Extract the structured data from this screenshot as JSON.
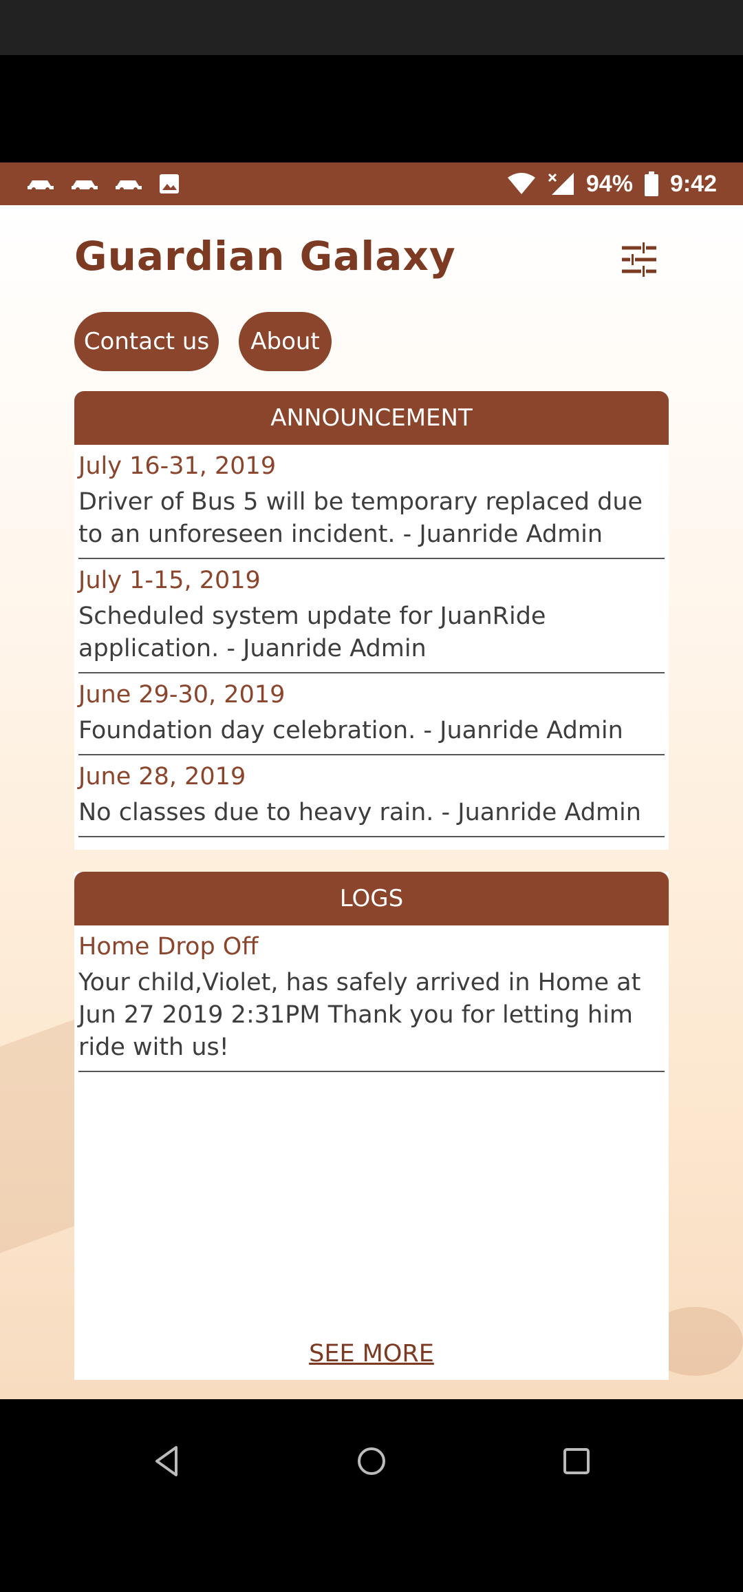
{
  "status": {
    "battery": "94%",
    "time": "9:42",
    "colors": {
      "bar": "#8b452c"
    },
    "icons": [
      "car-icon",
      "car-icon",
      "car-icon",
      "image-icon",
      "wifi-icon",
      "signal-icon",
      "battery-icon"
    ]
  },
  "app": {
    "title": "Guardian Galaxy",
    "buttons": {
      "contact": "Contact us",
      "about": "About"
    },
    "accent": "#8b452c"
  },
  "announcement": {
    "header": "ANNOUNCEMENT",
    "items": [
      {
        "date": "July 16-31, 2019",
        "text": "Driver of Bus 5 will be temporary replaced due to an unforeseen incident. - Juanride Admin"
      },
      {
        "date": "July 1-15, 2019",
        "text": "Scheduled system update for JuanRide application. - Juanride Admin"
      },
      {
        "date": "June 29-30, 2019",
        "text": "Foundation day celebration. - Juanride Admin"
      },
      {
        "date": "June 28, 2019",
        "text": "No classes due to heavy rain. - Juanride Admin"
      }
    ]
  },
  "logs": {
    "header": "LOGS",
    "items": [
      {
        "title": "Home Drop Off",
        "text": "Your child,Violet, has safely arrived in Home at Jun 27 2019  2:31PM Thank you for letting him ride with us!"
      }
    ],
    "see_more": "SEE MORE"
  }
}
